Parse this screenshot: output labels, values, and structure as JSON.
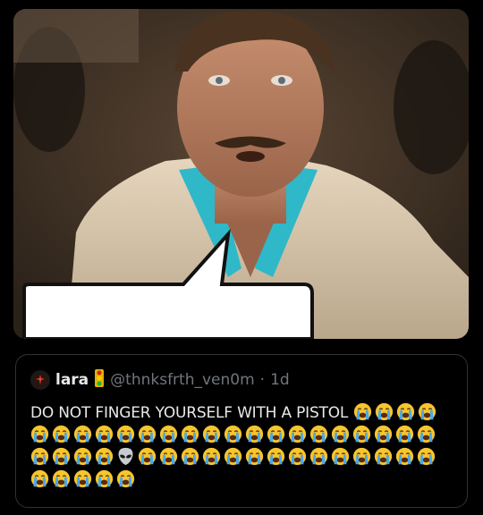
{
  "quote": {
    "name": "lara",
    "handle": "@thnksfrth_ven0m",
    "separator": "·",
    "time": "1d",
    "text": "DO NOT FINGER YOURSELF WITH A PISTOL",
    "emoji_sequence": [
      "loudly-crying",
      "loudly-crying",
      "loudly-crying",
      "loudly-crying",
      "loudly-crying",
      "loudly-crying",
      "loudly-crying",
      "loudly-crying",
      "loudly-crying",
      "loudly-crying",
      "loudly-crying",
      "loudly-crying",
      "loudly-crying",
      "loudly-crying",
      "loudly-crying",
      "loudly-crying",
      "loudly-crying",
      "loudly-crying",
      "loudly-crying",
      "loudly-crying",
      "loudly-crying",
      "loudly-crying",
      "loudly-crying",
      "loudly-crying",
      "loudly-crying",
      "loudly-crying",
      "loudly-crying",
      "alien",
      "loudly-crying",
      "loudly-crying",
      "loudly-crying",
      "loudly-crying",
      "loudly-crying",
      "loudly-crying",
      "loudly-crying",
      "loudly-crying",
      "loudly-crying",
      "loudly-crying",
      "loudly-crying",
      "loudly-crying",
      "loudly-crying",
      "loudly-crying",
      "loudly-crying",
      "loudly-crying",
      "loudly-crying",
      "loudly-crying",
      "loudly-crying"
    ]
  },
  "colors": {
    "background": "#000000",
    "text": "#e7e9ea",
    "secondary": "#71767b",
    "border": "#2f3336"
  },
  "icons": {
    "avatar": "sparkle-figure-icon",
    "name_badge": "traffic-light-icon"
  }
}
